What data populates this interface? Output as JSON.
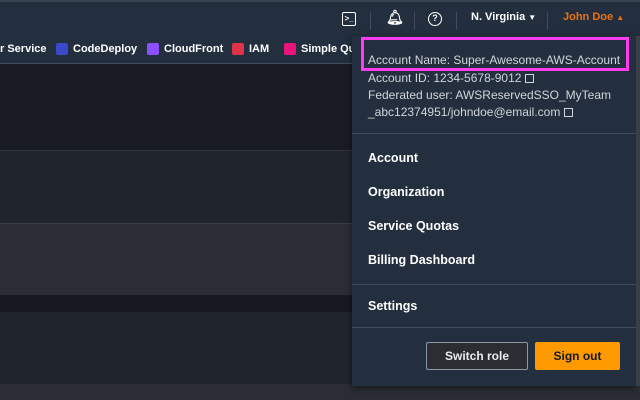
{
  "topbar": {
    "cloudshell_icon": "terminal-icon",
    "notifications_icon": "bell-icon",
    "help_icon": "help-circle-icon",
    "region": "N. Virginia",
    "user": "John Doe",
    "user_color": "#ec7211"
  },
  "favorites": [
    {
      "label": "r Service",
      "color": ""
    },
    {
      "label": "CodeDeploy",
      "color": "#3b48cc"
    },
    {
      "label": "CloudFront",
      "color": "#8c4fff"
    },
    {
      "label": "IAM",
      "color": "#dd344c"
    },
    {
      "label": "Simple Qu",
      "color": "#e7157b"
    }
  ],
  "account": {
    "name": "Account Name: Super-Awesome-AWS-Account",
    "id": "Account ID: 1234-5678-9012",
    "federated_1": "Federated user: AWSReservedSSO_MyTeam",
    "federated_2": "_abc12374951/johndoe@email.com",
    "highlight_color": "#ff3df0"
  },
  "menu": [
    "Account",
    "Organization",
    "Service Quotas",
    "Billing Dashboard",
    "Settings"
  ],
  "buttons": {
    "switch_role": "Switch role",
    "sign_out": "Sign out",
    "sign_out_color": "#ff9900"
  }
}
